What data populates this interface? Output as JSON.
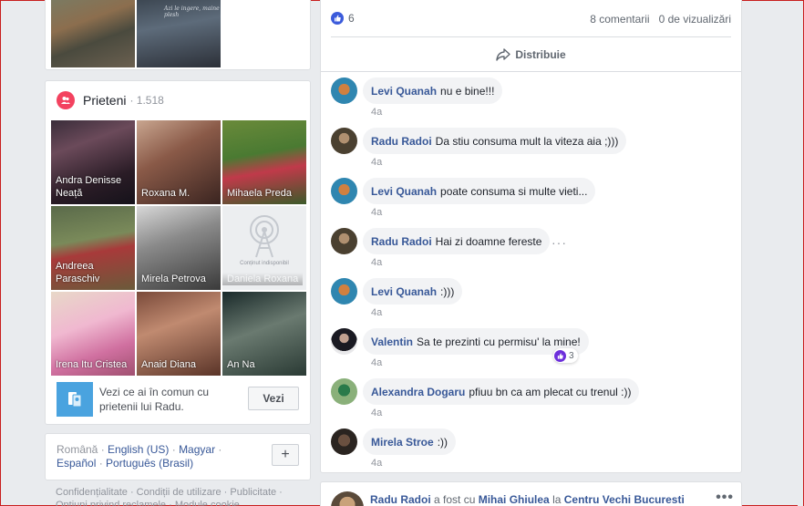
{
  "photos": {
    "photo_2_caption": "Azi le ingere, maine plesh"
  },
  "friends": {
    "title": "Prieteni",
    "count": "· 1.518",
    "items": [
      {
        "name": "Andra Denisse Neață"
      },
      {
        "name": "Roxana M."
      },
      {
        "name": "Mihaela Preda"
      },
      {
        "name": "Andreea Paraschiv"
      },
      {
        "name": "Mirela Petrova"
      },
      {
        "name": "Daniela Roxana"
      },
      {
        "name": "Irena Itu Cristea"
      },
      {
        "name": "Anaid Diana"
      },
      {
        "name": "An Na"
      }
    ],
    "unavailable_label": "Conținut indisponibil",
    "compare_text": "Vezi ce ai în comun cu prietenii lui Radu.",
    "compare_button": "Vezi"
  },
  "languages": {
    "current": "Română",
    "links": [
      "English (US)",
      "Magyar",
      "Español",
      "Português (Brasil)"
    ],
    "add_button": "+"
  },
  "footer": {
    "text": "Confidențialitate · Condiții de utilizare · Publicitate · Opțiuni privind reclamele · Module cookie"
  },
  "post": {
    "reaction_count": "6",
    "comments_count": "8 comentarii",
    "views_count": "0 de vizualizări",
    "share_label": "Distribuie",
    "comments": [
      {
        "author": "Levi Quanah",
        "text": "nu e bine!!!",
        "time": "4a"
      },
      {
        "author": "Radu Radoi",
        "text": "Da stiu consuma mult la viteza aia ;)))",
        "time": "4a"
      },
      {
        "author": "Levi Quanah",
        "text": "poate consuma si multe vieti...",
        "time": "4a"
      },
      {
        "author": "Radu Radoi",
        "text": "Hai zi doamne fereste",
        "time": "4a",
        "more": "···"
      },
      {
        "author": "Levi Quanah",
        "text": ":)))",
        "time": "4a"
      },
      {
        "author": "Valentin",
        "text": "Sa te prezinti cu permisu' la mine!",
        "time": "4a",
        "reactions": "3"
      },
      {
        "author": "Alexandra Dogaru",
        "text": "pfiuu bn ca am plecat cu trenul :))",
        "time": "4a"
      },
      {
        "author": "Mirela Stroe",
        "text": ":))",
        "time": "4a"
      }
    ]
  },
  "next_post": {
    "author": "Radu Radoi",
    "text_1": "a fost cu",
    "tagged": "Mihai Ghiulea",
    "text_2": "la",
    "place": "Centru Vechi Bucuresti",
    "more": "•••"
  },
  "colors": {
    "accent": "#385898",
    "like_blue": "#2d88ff",
    "friends_icon": "#f3425f",
    "background": "#e9ebee"
  }
}
